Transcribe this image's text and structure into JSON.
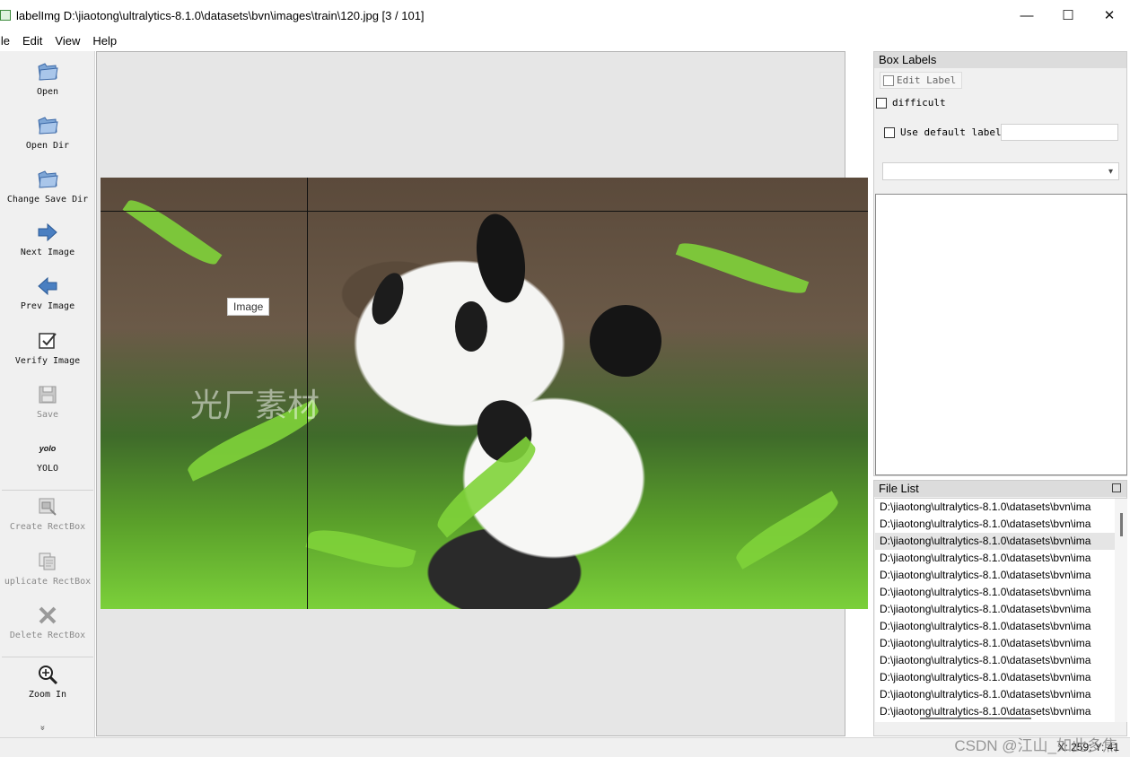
{
  "window": {
    "title": "labelImg D:\\jiaotong\\ultralytics-8.1.0\\datasets\\bvn\\images\\train\\120.jpg [3 / 101]",
    "minimize": "—",
    "maximize": "☐",
    "close": "✕"
  },
  "menu": [
    "ile",
    "Edit",
    "View",
    "Help"
  ],
  "toolbar": {
    "open": "Open",
    "open_dir": "Open Dir",
    "change_save_dir": "Change Save Dir",
    "next_image": "Next Image",
    "prev_image": "Prev Image",
    "verify_image": "Verify Image",
    "save": "Save",
    "yolo_icon_text": "yolo",
    "yolo": "YOLO",
    "create_rectbox": "Create RectBox",
    "duplicate_rectbox": "uplicate RectBox",
    "delete_rectbox": "Delete RectBox",
    "zoom_in": "Zoom In",
    "more": "»"
  },
  "canvas": {
    "tooltip": "Image",
    "watermark": "光厂素材"
  },
  "box_labels": {
    "title": "Box Labels",
    "edit_label": "Edit Label",
    "difficult": "difficult",
    "use_default_label": "Use default label",
    "default_label_value": "",
    "combo_value": ""
  },
  "file_list": {
    "title": "File List",
    "selected_index": 2,
    "items": [
      "D:\\jiaotong\\ultralytics-8.1.0\\datasets\\bvn\\ima",
      "D:\\jiaotong\\ultralytics-8.1.0\\datasets\\bvn\\ima",
      "D:\\jiaotong\\ultralytics-8.1.0\\datasets\\bvn\\ima",
      "D:\\jiaotong\\ultralytics-8.1.0\\datasets\\bvn\\ima",
      "D:\\jiaotong\\ultralytics-8.1.0\\datasets\\bvn\\ima",
      "D:\\jiaotong\\ultralytics-8.1.0\\datasets\\bvn\\ima",
      "D:\\jiaotong\\ultralytics-8.1.0\\datasets\\bvn\\ima",
      "D:\\jiaotong\\ultralytics-8.1.0\\datasets\\bvn\\ima",
      "D:\\jiaotong\\ultralytics-8.1.0\\datasets\\bvn\\ima",
      "D:\\jiaotong\\ultralytics-8.1.0\\datasets\\bvn\\ima",
      "D:\\jiaotong\\ultralytics-8.1.0\\datasets\\bvn\\ima",
      "D:\\jiaotong\\ultralytics-8.1.0\\datasets\\bvn\\ima",
      "D:\\jiaotong\\ultralytics-8.1.0\\datasets\\bvn\\ima"
    ]
  },
  "status": {
    "coords": "X: 259; Y: 41",
    "watermark": "CSDN @江山_如此多焦"
  },
  "icons": {
    "open": "folder-icon",
    "next": "arrow-right-icon",
    "prev": "arrow-left-icon",
    "verify": "checkbox-icon",
    "save": "floppy-icon",
    "zoom": "magnifier-icon",
    "delete": "x-icon"
  },
  "colors": {
    "accent_blue": "#4a7fc1",
    "panel_header": "#dcdcdc",
    "selected_row": "#e5e5e5"
  }
}
